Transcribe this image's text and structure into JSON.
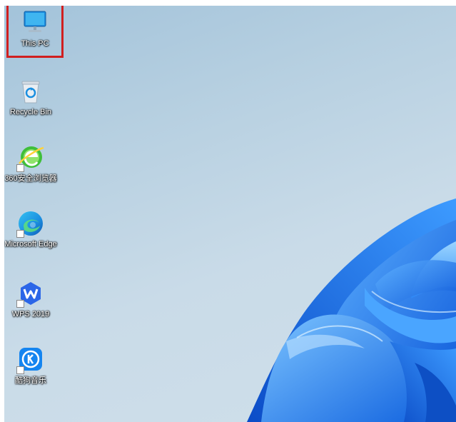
{
  "desktop": {
    "icons": [
      {
        "label": "This PC",
        "icon": "monitor-icon"
      },
      {
        "label": "Recycle Bin",
        "icon": "recycle-bin-icon"
      },
      {
        "label": "360安全浏览器",
        "icon": "browser-360-icon"
      },
      {
        "label": "Microsoft Edge",
        "icon": "edge-icon"
      },
      {
        "label": "WPS 2019",
        "icon": "wps-icon"
      },
      {
        "label": "酷狗音乐",
        "icon": "kugou-icon"
      }
    ],
    "highlight_color": "#d01f1f",
    "accent_color": "#1a73e8"
  }
}
